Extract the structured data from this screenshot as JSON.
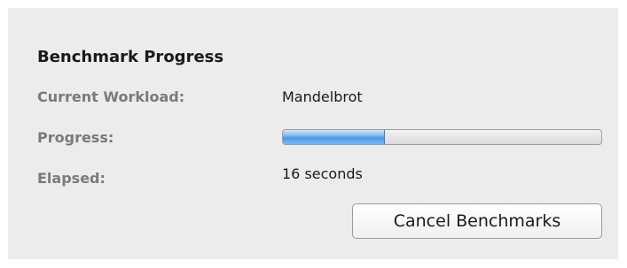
{
  "window": {
    "title": "Benchmark Progress"
  },
  "fields": {
    "workload_label": "Current Workload:",
    "workload_value": "Mandelbrot",
    "progress_label": "Progress:",
    "progress_fraction": 0.32,
    "elapsed_label": "Elapsed:",
    "elapsed_value": "16 seconds"
  },
  "actions": {
    "cancel_label": "Cancel Benchmarks"
  },
  "colors": {
    "panel_background": "#ececec",
    "progress_accent": "#4f97e6"
  }
}
